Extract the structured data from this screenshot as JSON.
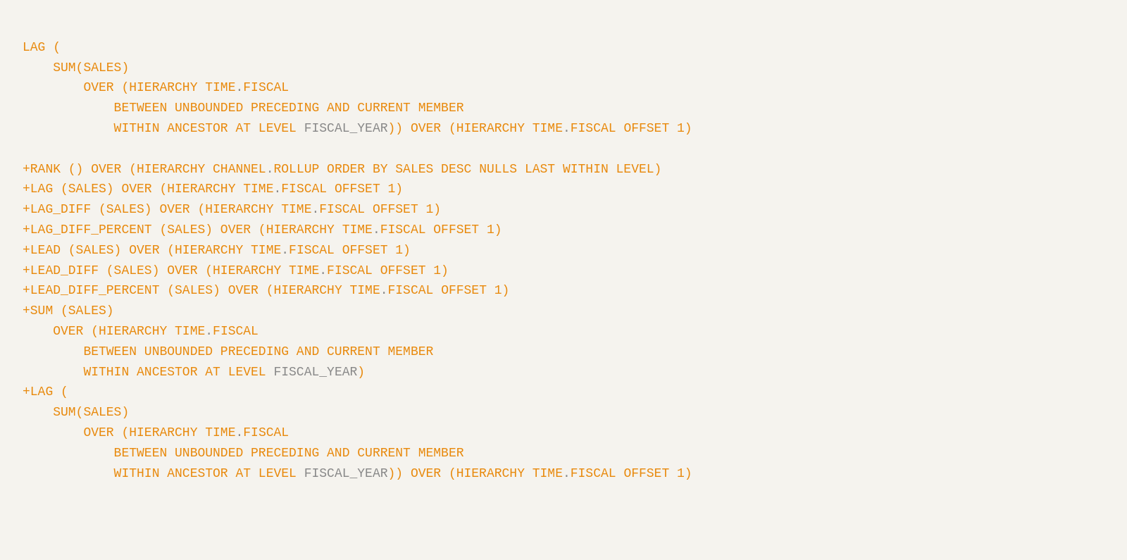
{
  "colors": {
    "orange": "#e8890c",
    "gray": "#888888",
    "background": "#f5f3ee"
  },
  "code": {
    "lines": [
      {
        "segments": [
          {
            "text": "LAG (",
            "color": "orange"
          }
        ]
      },
      {
        "segments": [
          {
            "text": "    SUM(SALES)",
            "color": "orange"
          }
        ]
      },
      {
        "segments": [
          {
            "text": "        OVER (",
            "color": "orange"
          },
          {
            "text": "HIERARCHY TIME",
            "color": "orange"
          },
          {
            "text": ".",
            "color": "gray"
          },
          {
            "text": "FISCAL",
            "color": "orange"
          }
        ]
      },
      {
        "segments": [
          {
            "text": "            BETWEEN UNBOUNDED PRECEDING AND CURRENT MEMBER",
            "color": "orange"
          }
        ]
      },
      {
        "segments": [
          {
            "text": "            WITHIN ANCESTOR AT LEVEL ",
            "color": "orange"
          },
          {
            "text": "FISCAL_YEAR",
            "color": "gray"
          },
          {
            "text": ")) OVER (",
            "color": "orange"
          },
          {
            "text": "HIERARCHY TIME",
            "color": "orange"
          },
          {
            "text": ".",
            "color": "gray"
          },
          {
            "text": "FISCAL OFFSET 1)",
            "color": "orange"
          }
        ]
      },
      {
        "segments": []
      },
      {
        "segments": [
          {
            "text": "+RANK () OVER (",
            "color": "orange"
          },
          {
            "text": "HIERARCHY CHANNEL",
            "color": "orange"
          },
          {
            "text": ".",
            "color": "gray"
          },
          {
            "text": "ROLLUP ORDER BY SALES DESC NULLS LAST WITHIN LEVEL)",
            "color": "orange"
          }
        ]
      },
      {
        "segments": [
          {
            "text": "+LAG (SALES) OVER (",
            "color": "orange"
          },
          {
            "text": "HIERARCHY TIME",
            "color": "orange"
          },
          {
            "text": ".",
            "color": "gray"
          },
          {
            "text": "FISCAL OFFSET 1)",
            "color": "orange"
          }
        ]
      },
      {
        "segments": [
          {
            "text": "+LAG_DIFF (SALES) OVER (",
            "color": "orange"
          },
          {
            "text": "HIERARCHY TIME",
            "color": "orange"
          },
          {
            "text": ".",
            "color": "gray"
          },
          {
            "text": "FISCAL OFFSET 1)",
            "color": "orange"
          }
        ]
      },
      {
        "segments": [
          {
            "text": "+LAG_DIFF_PERCENT (SALES) OVER (",
            "color": "orange"
          },
          {
            "text": "HIERARCHY TIME",
            "color": "orange"
          },
          {
            "text": ".",
            "color": "gray"
          },
          {
            "text": "FISCAL OFFSET 1)",
            "color": "orange"
          }
        ]
      },
      {
        "segments": [
          {
            "text": "+LEAD (SALES) OVER (",
            "color": "orange"
          },
          {
            "text": "HIERARCHY TIME",
            "color": "orange"
          },
          {
            "text": ".",
            "color": "gray"
          },
          {
            "text": "FISCAL OFFSET 1)",
            "color": "orange"
          }
        ]
      },
      {
        "segments": [
          {
            "text": "+LEAD_DIFF (SALES) OVER (",
            "color": "orange"
          },
          {
            "text": "HIERARCHY TIME",
            "color": "orange"
          },
          {
            "text": ".",
            "color": "gray"
          },
          {
            "text": "FISCAL OFFSET 1)",
            "color": "orange"
          }
        ]
      },
      {
        "segments": [
          {
            "text": "+LEAD_DIFF_PERCENT (SALES) OVER (",
            "color": "orange"
          },
          {
            "text": "HIERARCHY TIME",
            "color": "orange"
          },
          {
            "text": ".",
            "color": "gray"
          },
          {
            "text": "FISCAL OFFSET 1)",
            "color": "orange"
          }
        ]
      },
      {
        "segments": [
          {
            "text": "+SUM (SALES)",
            "color": "orange"
          }
        ]
      },
      {
        "segments": [
          {
            "text": "    OVER (",
            "color": "orange"
          },
          {
            "text": "HIERARCHY TIME",
            "color": "orange"
          },
          {
            "text": ".",
            "color": "gray"
          },
          {
            "text": "FISCAL",
            "color": "orange"
          }
        ]
      },
      {
        "segments": [
          {
            "text": "        BETWEEN UNBOUNDED PRECEDING AND CURRENT MEMBER",
            "color": "orange"
          }
        ]
      },
      {
        "segments": [
          {
            "text": "        WITHIN ANCESTOR AT LEVEL ",
            "color": "orange"
          },
          {
            "text": "FISCAL_YEAR",
            "color": "gray"
          },
          {
            "text": ")",
            "color": "orange"
          }
        ]
      },
      {
        "segments": [
          {
            "text": "+LAG (",
            "color": "orange"
          }
        ]
      },
      {
        "segments": [
          {
            "text": "    SUM(SALES)",
            "color": "orange"
          }
        ]
      },
      {
        "segments": [
          {
            "text": "        OVER (",
            "color": "orange"
          },
          {
            "text": "HIERARCHY TIME",
            "color": "orange"
          },
          {
            "text": ".",
            "color": "gray"
          },
          {
            "text": "FISCAL",
            "color": "orange"
          }
        ]
      },
      {
        "segments": [
          {
            "text": "            BETWEEN UNBOUNDED PRECEDING AND CURRENT MEMBER",
            "color": "orange"
          }
        ]
      },
      {
        "segments": [
          {
            "text": "            WITHIN ANCESTOR AT LEVEL ",
            "color": "orange"
          },
          {
            "text": "FISCAL_YEAR",
            "color": "gray"
          },
          {
            "text": ")) OVER (",
            "color": "orange"
          },
          {
            "text": "HIERARCHY TIME",
            "color": "orange"
          },
          {
            "text": ".",
            "color": "gray"
          },
          {
            "text": "FISCAL OFFSET 1)",
            "color": "orange"
          }
        ]
      }
    ]
  }
}
